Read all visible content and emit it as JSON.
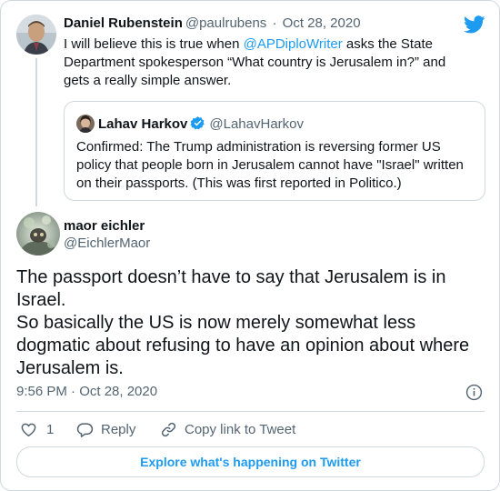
{
  "parent_tweet": {
    "name": "Daniel Rubenstein",
    "handle": "@paulrubens",
    "separator": "·",
    "date": "Oct 28, 2020",
    "text_before": "I will believe this is true when ",
    "mention": "@APDiploWriter",
    "text_after": " asks the State Department spokesperson “What country is Jerusalem in?” and gets a really simple answer."
  },
  "quoted_tweet": {
    "name": "Lahav Harkov",
    "handle": "@LahavHarkov",
    "text": "Confirmed: The Trump administration is reversing former US policy that people born in Jerusalem cannot have \"Israel\" written on their passports. (This was first reported in Politico.)"
  },
  "main_tweet": {
    "name": "maor eichler",
    "handle": "@EichlerMaor",
    "text": "The passport doesn’t have to say that Jerusalem is in Israel.\nSo basically the US is now merely somewhat less dogmatic about refusing to have an opinion about where Jerusalem is.",
    "timestamp": "9:56 PM · Oct 28, 2020"
  },
  "actions": {
    "like_count": "1",
    "reply_label": "Reply",
    "copy_link_label": "Copy link to Tweet"
  },
  "footer": {
    "explore_label": "Explore what's happening on Twitter"
  },
  "colors": {
    "accent": "#1d9bf0",
    "secondary_text": "#536471",
    "border": "#cfd9de"
  },
  "icons": [
    "twitter-logo-icon",
    "verified-badge-icon",
    "info-icon",
    "heart-icon",
    "reply-icon",
    "link-icon"
  ]
}
